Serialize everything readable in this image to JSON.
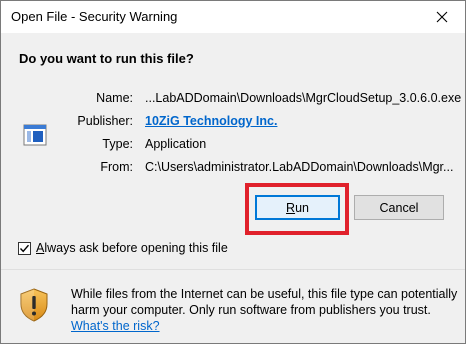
{
  "window": {
    "title": "Open File - Security Warning"
  },
  "prompt": {
    "question": "Do you want to run this file?"
  },
  "details": {
    "name_label": "Name:",
    "name_value": "...LabADDomain\\Downloads\\MgrCloudSetup_3.0.6.0.exe",
    "publisher_label": "Publisher:",
    "publisher_value": "10ZiG Technology Inc.",
    "type_label": "Type:",
    "type_value": "Application",
    "from_label": "From:",
    "from_value": "C:\\Users\\administrator.LabADDomain\\Downloads\\Mgr..."
  },
  "buttons": {
    "run_prefix": "",
    "run_accel": "R",
    "run_rest": "un",
    "cancel_label": "Cancel"
  },
  "checkbox": {
    "prefix": "",
    "accel": "A",
    "rest": "lways ask before opening this file",
    "checked": true
  },
  "warning": {
    "text": "While files from the Internet can be useful, this file type can potentially harm your computer. Only run software from publishers you trust.",
    "link": "What's the risk?"
  },
  "colors": {
    "link": "#0066cc",
    "highlight": "#e0212b",
    "primary_border": "#0078d7"
  },
  "icons": {
    "close": "close-icon",
    "app": "application-icon",
    "checkbox": "checkmark-icon",
    "shield": "shield-warning-icon"
  }
}
